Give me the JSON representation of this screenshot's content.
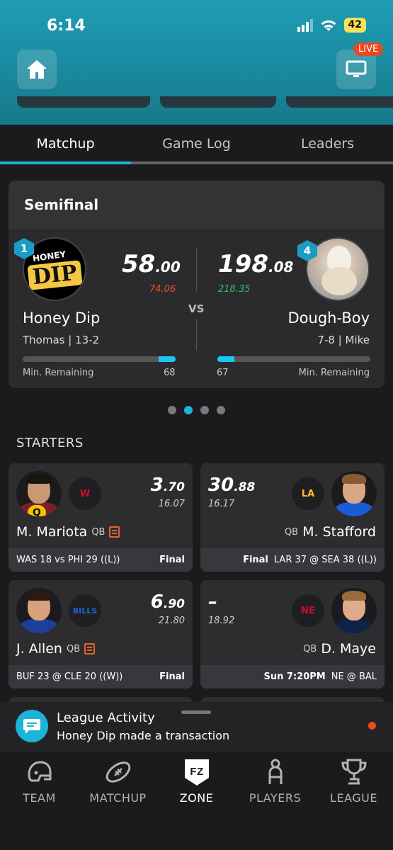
{
  "status_bar": {
    "time": "6:14",
    "battery": "42"
  },
  "header": {
    "live_badge": "LIVE"
  },
  "tabs": [
    {
      "label": "Matchup",
      "active": true
    },
    {
      "label": "Game Log",
      "active": false
    },
    {
      "label": "Leaders",
      "active": false
    }
  ],
  "matchup": {
    "round": "Semifinal",
    "vs": "VS",
    "home": {
      "seed": "1",
      "logo_text_top": "HONEY",
      "logo_text_bottom": "DIP",
      "score_whole": "58",
      "score_dec": ".00",
      "projected": "74.06",
      "team": "Honey Dip",
      "owner_record": "Thomas | 13-2",
      "min_label": "Min. Remaining",
      "min_remaining": "68",
      "progress": 0.11
    },
    "away": {
      "seed": "4",
      "score_whole": "198",
      "score_dec": ".08",
      "projected": "218.35",
      "team": "Dough-Boy",
      "owner_record": "7-8 | Mike",
      "min_label": "Min. Remaining",
      "min_remaining": "67",
      "progress": 0.11
    }
  },
  "carousel": {
    "count": 4,
    "active": 1
  },
  "starters_label": "STARTERS",
  "players": [
    {
      "team_logo": "W",
      "score_whole": "3",
      "score_dec": ".70",
      "projected": "16.07",
      "name": "M. Mariota",
      "pos": "QB",
      "injury": "Q",
      "game": "WAS 18 vs PHI 29 ((L))",
      "status": "Final"
    },
    {
      "team_logo": "LA",
      "score_whole": "30",
      "score_dec": ".88",
      "projected": "16.17",
      "name": "M. Stafford",
      "pos": "QB",
      "game": "LAR 37 @ SEA 38 ((L))",
      "status": "Final"
    },
    {
      "team_logo": "BILLS",
      "score_whole": "6",
      "score_dec": ".90",
      "projected": "21.80",
      "name": "J. Allen",
      "pos": "QB",
      "game": "BUF 23 @ CLE 20 ((W))",
      "status": "Final"
    },
    {
      "team_logo": "NE",
      "score_whole": "–",
      "score_dec": "",
      "projected": "18.92",
      "name": "D. Maye",
      "pos": "QB",
      "game": "NE @ BAL",
      "status": "Sun 7:20PM"
    }
  ],
  "activity": {
    "title": "League Activity",
    "subtitle": "Honey Dip made a transaction"
  },
  "nav": [
    {
      "label": "TEAM",
      "icon": "helmet-icon"
    },
    {
      "label": "MATCHUP",
      "icon": "football-icon"
    },
    {
      "label": "ZONE",
      "icon": "fz-shield-icon",
      "active": true
    },
    {
      "label": "PLAYERS",
      "icon": "person-icon"
    },
    {
      "label": "LEAGUE",
      "icon": "trophy-icon"
    }
  ],
  "colors": {
    "accent": "#1cb4d8",
    "live": "#e84a1f",
    "loss_proj": "#e8502a",
    "win_proj": "#2fc262"
  }
}
